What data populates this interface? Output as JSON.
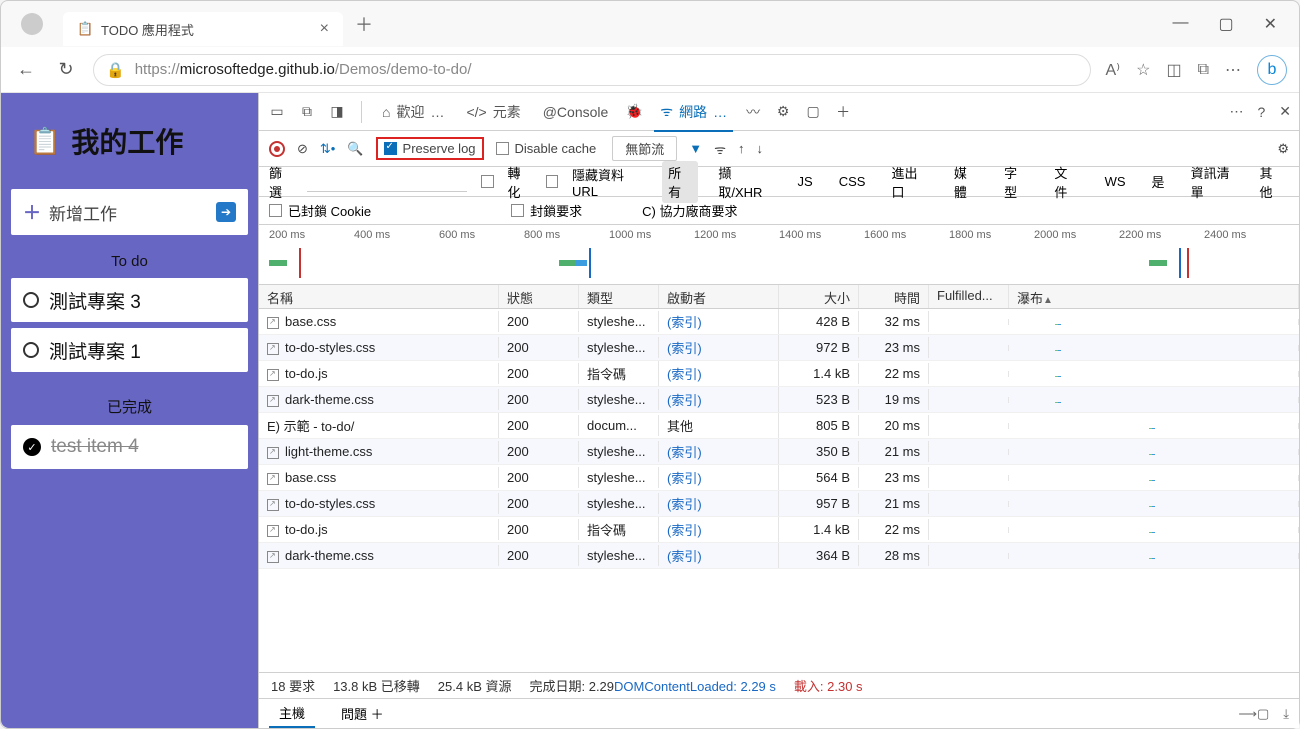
{
  "browser": {
    "tab_title": "TODO 應用程式",
    "url_prefix": "https://",
    "url_host": "microsoftedge.github.io",
    "url_path": "/Demos/demo-to-do/"
  },
  "app": {
    "title": "我的工作",
    "add_placeholder": "新增工作",
    "section_todo": "To do",
    "section_done": "已完成",
    "items_todo": [
      {
        "label": "測試專案 3"
      },
      {
        "label": "測試專案 1"
      }
    ],
    "items_done": [
      {
        "label": "test item 4"
      }
    ]
  },
  "devtools": {
    "tabs": {
      "welcome": "歡迎",
      "elements": "元素",
      "console": "@Console",
      "network": "網路"
    },
    "toolbar": {
      "preserve_log": "Preserve log",
      "disable_cache": "Disable cache",
      "throttling": "無節流"
    },
    "filter": {
      "label": "篩選",
      "invert": "轉化",
      "hide_data": "隱藏資料 URL",
      "all": "所有",
      "fetch": "擷取/XHR",
      "js": "JS",
      "css": "CSS",
      "font": "進出口",
      "media": "媒體",
      "img": "字型",
      "doc": "文件",
      "ws": "WS",
      "wasm": "是",
      "manifest": "資訊清單",
      "other": "其他"
    },
    "cookie": {
      "blocked": "已封鎖 Cookie",
      "blocked_req": "封鎖要求",
      "third": "C) 協力廠商要求"
    },
    "timeline_ticks": [
      "200 ms",
      "400 ms",
      "600 ms",
      "800 ms",
      "1000 ms",
      "1200 ms",
      "1400 ms",
      "1600 ms",
      "1800 ms",
      "2000 ms",
      "2200 ms",
      "2400 ms"
    ],
    "columns": {
      "name": "名稱",
      "status": "狀態",
      "type": "類型",
      "initiator": "啟動者",
      "size": "大小",
      "time": "時間",
      "fulfilled": "Fulfilled...",
      "waterfall": "瀑布"
    },
    "rows": [
      {
        "name": "base.css",
        "status": "200",
        "type": "styleshe...",
        "init": "(索引)",
        "size": "428 B",
        "time": "32 ms",
        "wx": 46
      },
      {
        "name": "to-do-styles.css",
        "status": "200",
        "type": "styleshe...",
        "init": "(索引)",
        "size": "972 B",
        "time": "23 ms",
        "wx": 46
      },
      {
        "name": "to-do.js",
        "status": "200",
        "type": "指令碼",
        "init": "(索引)",
        "size": "1.4 kB",
        "time": "22 ms",
        "wx": 46
      },
      {
        "name": "dark-theme.css",
        "status": "200",
        "type": "styleshe...",
        "init": "(索引)",
        "size": "523 B",
        "time": "19 ms",
        "wx": 46
      },
      {
        "name": "E) 示範 - to-do/",
        "status": "200",
        "type": "docum...",
        "init": "其他",
        "size": "805 B",
        "time": "20 ms",
        "wx": 140,
        "noicon": true
      },
      {
        "name": "light-theme.css",
        "status": "200",
        "type": "styleshe...",
        "init": "(索引)",
        "size": "350 B",
        "time": "21 ms",
        "wx": 140
      },
      {
        "name": "base.css",
        "status": "200",
        "type": "styleshe...",
        "init": "(索引)",
        "size": "564 B",
        "time": "23 ms",
        "wx": 140
      },
      {
        "name": "to-do-styles.css",
        "status": "200",
        "type": "styleshe...",
        "init": "(索引)",
        "size": "957 B",
        "time": "21 ms",
        "wx": 140
      },
      {
        "name": "to-do.js",
        "status": "200",
        "type": "指令碼",
        "init": "(索引)",
        "size": "1.4 kB",
        "time": "22 ms",
        "wx": 140
      },
      {
        "name": "dark-theme.css",
        "status": "200",
        "type": "styleshe...",
        "init": "(索引)",
        "size": "364 B",
        "time": "28 ms",
        "wx": 140
      }
    ],
    "footer": {
      "requests": "18 要求",
      "transferred": "13.8 kB 已移轉",
      "resources": "25.4 kB 資源",
      "finish": "完成日期: 2.29DOMContentLoaded: 2.29 s",
      "load": "載入: 2.30 s"
    },
    "drawer": {
      "main": "主機",
      "issues": "問題"
    }
  }
}
